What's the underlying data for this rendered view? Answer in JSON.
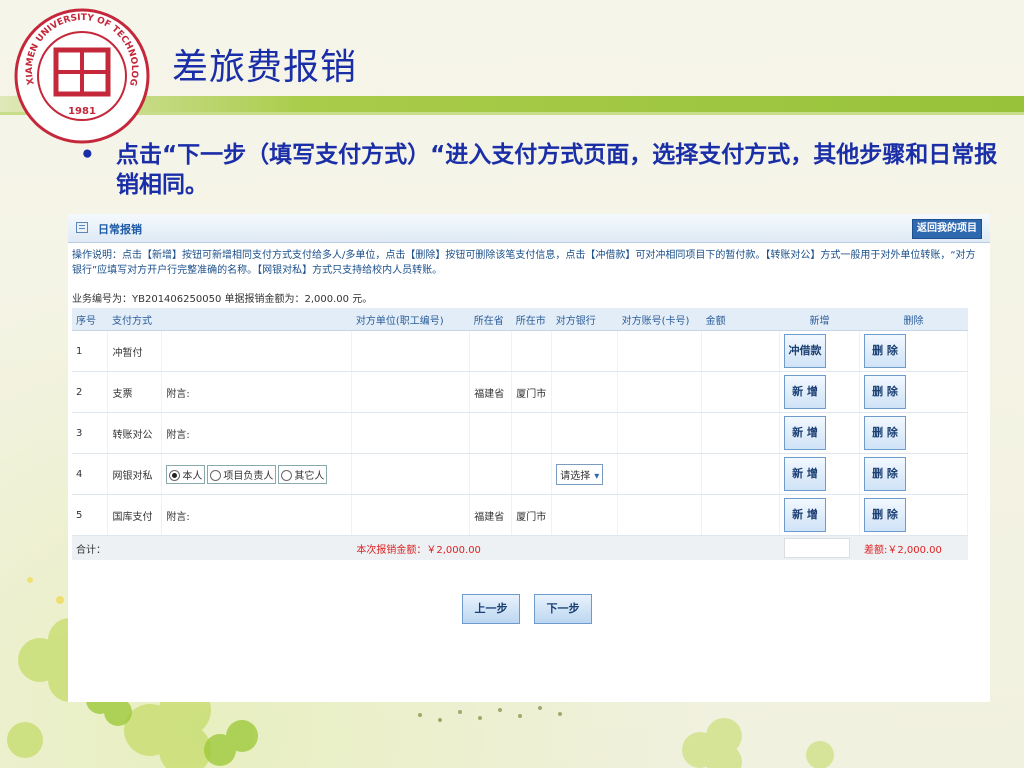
{
  "slide": {
    "title": "差旅费报销",
    "bullet_marker": "•",
    "bullet_text": "点击“下一步（填写支付方式）“进入支付方式页面，选择支付方式，其他步骤和日常报销相同。",
    "logo": {
      "arc_text": "XIAMEN UNIVERSITY OF TECHNOLOGY",
      "year": "1981",
      "color": "#c4283a"
    }
  },
  "panel": {
    "header_title": "日常报销",
    "header_button": "返回我的项目",
    "instructions": "操作说明：点击【新增】按钮可新增相同支付方式支付给多人/多单位，点击【删除】按钮可删除该笔支付信息，点击【冲借款】可对冲相同项目下的暂付款。【转账对公】方式一般用于对外单位转账，“对方银行”应填写对方开户行完整准确的名称。【网银对私】方式只支持给校内人员转账。",
    "biz_info": "业务编号为：YB201406250050   单据报销金额为：2,000.00 元。",
    "columns": [
      "序号",
      "支付方式",
      "",
      "对方单位(职工编号)",
      "所在省",
      "所在市",
      "对方银行",
      "对方账号(卡号)",
      "金额",
      "新增",
      "删除"
    ],
    "rows": [
      {
        "no": "1",
        "method": "冲暂付",
        "note": "",
        "province": "",
        "city": "",
        "add_btn": "冲借款",
        "del_btn": "删 除"
      },
      {
        "no": "2",
        "method": "支票",
        "note": "附言:",
        "province": "福建省",
        "city": "厦门市",
        "add_btn": "新 增",
        "del_btn": "删 除"
      },
      {
        "no": "3",
        "method": "转账对公",
        "note": "附言:",
        "province": "",
        "city": "",
        "add_btn": "新 增",
        "del_btn": "删 除"
      },
      {
        "no": "4",
        "method": "网银对私",
        "note": "",
        "province": "",
        "city": "",
        "bank_select": "请选择",
        "add_btn": "新 增",
        "del_btn": "删 除"
      },
      {
        "no": "5",
        "method": "国库支付",
        "note": "附言:",
        "province": "福建省",
        "city": "厦门市",
        "add_btn": "新 增",
        "del_btn": "删 除"
      }
    ],
    "radio_options": [
      "本人",
      "项目负责人",
      "其它人"
    ],
    "radio_selected": 0,
    "total_label": "合计：",
    "total_amount": "本次报销金额：￥2,000.00",
    "difference": "差额:￥2,000.00",
    "prev_button": "上一步",
    "next_button": "下一步"
  },
  "colors": {
    "title_blue": "#1a2ea8",
    "accent_green": "#98c23a",
    "panel_blue": "#2e69b0",
    "warning_red": "#dd2222"
  }
}
